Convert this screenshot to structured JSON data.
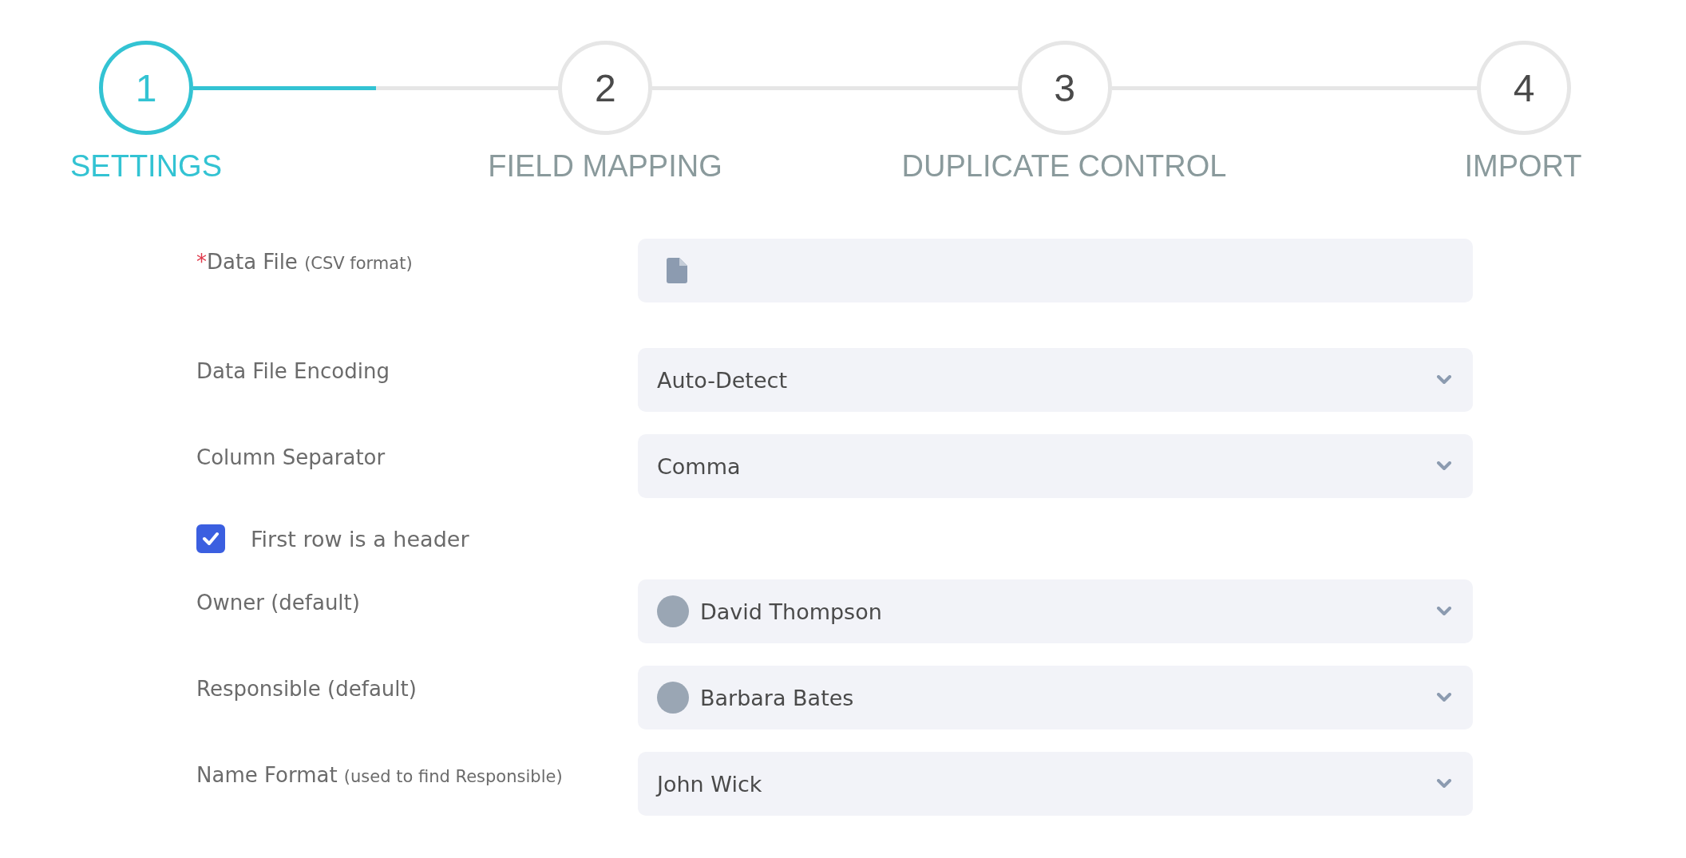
{
  "stepper": {
    "connectors": [
      {
        "level": 0.5
      }
    ],
    "steps": [
      {
        "number": "1",
        "label": "SETTINGS",
        "selected": true
      },
      {
        "number": "2",
        "label": "FIELD MAPPING",
        "selected": false
      },
      {
        "number": "3",
        "label": "DUPLICATE CONTROL",
        "selected": false
      },
      {
        "number": "4",
        "label": "IMPORT",
        "selected": false
      }
    ]
  },
  "form": {
    "rows": [
      {
        "kind": "file",
        "required_mark": "*",
        "label": "Data File",
        "hint": "(CSV format)"
      },
      {
        "kind": "select",
        "label": "Data File Encoding",
        "value": "Auto-Detect"
      },
      {
        "kind": "select",
        "label": "Column Separator",
        "value": "Comma"
      },
      {
        "kind": "checkbox",
        "label": "First row is a header",
        "checked": true
      },
      {
        "kind": "person",
        "label": "Owner (default)",
        "value": "David Thompson"
      },
      {
        "kind": "person",
        "label": "Responsible (default)",
        "value": "Barbara Bates"
      },
      {
        "kind": "select",
        "label": "Name Format",
        "hint": "(used to find Responsible)",
        "value": "John Wick"
      }
    ]
  }
}
